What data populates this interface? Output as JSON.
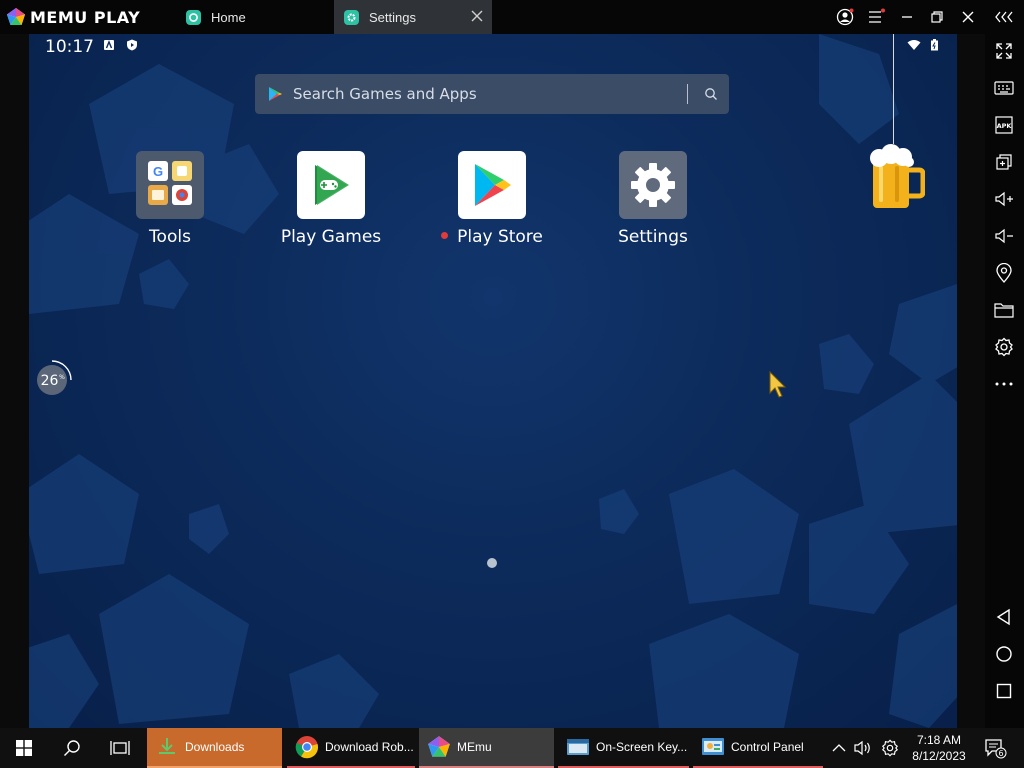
{
  "titlebar": {
    "brand": "MEMU PLAY",
    "tabs": [
      {
        "label": "Home",
        "icon": "memu-home-icon",
        "active": false
      },
      {
        "label": "Settings",
        "icon": "settings-gear-icon",
        "active": true
      }
    ]
  },
  "android": {
    "status": {
      "time": "10:17"
    },
    "search": {
      "placeholder": "Search Games and Apps"
    },
    "apps": [
      {
        "label": "Tools"
      },
      {
        "label": "Play Games"
      },
      {
        "label": "Play Store",
        "badge": "new"
      },
      {
        "label": "Settings"
      }
    ],
    "performance_percent": 26,
    "performance_label": "26",
    "performance_unit": "%"
  },
  "taskbar": {
    "items": [
      {
        "label": "Downloads"
      },
      {
        "label": "Download Rob..."
      },
      {
        "label": "MEmu"
      },
      {
        "label": "On-Screen Key..."
      },
      {
        "label": "Control Panel"
      }
    ],
    "time": "7:18 AM",
    "date": "8/12/2023",
    "notifications": "6"
  },
  "colors": {
    "accent_orange": "#c76a2c",
    "screen_bg": "#0c2a5a",
    "search_bg": "#3b4c66"
  }
}
